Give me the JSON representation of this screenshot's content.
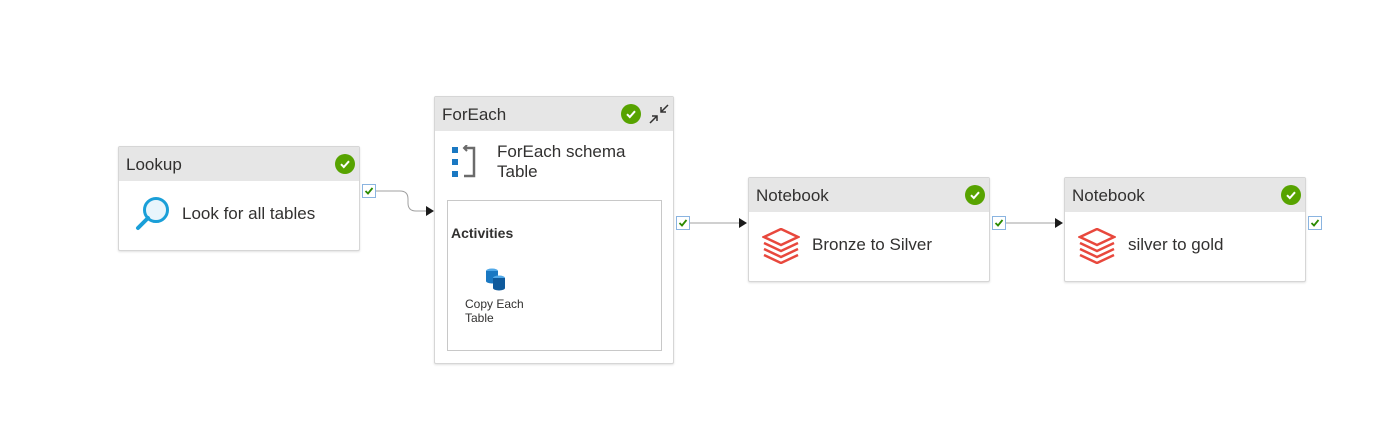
{
  "nodes": {
    "lookup": {
      "type_label": "Lookup",
      "title": "Look for all tables",
      "status": "succeeded"
    },
    "foreach": {
      "type_label": "ForEach",
      "title_line1": "ForEach schema",
      "title_line2": "Table",
      "activities_label": "Activities",
      "sub_activity": {
        "label_line1": "Copy Each",
        "label_line2": "Table"
      },
      "status": "succeeded"
    },
    "notebook1": {
      "type_label": "Notebook",
      "title": "Bronze to Silver",
      "status": "succeeded"
    },
    "notebook2": {
      "type_label": "Notebook",
      "title": "silver to gold",
      "status": "succeeded"
    }
  },
  "colors": {
    "success": "#57a300",
    "port_border": "#8ab4e0",
    "header_bg": "#e6e6e6",
    "databricks_red": "#e8483d",
    "lookup_blue": "#1a9fd8",
    "foreach_blue": "#1a78c2"
  },
  "icons": {
    "lookup": "magnifier-icon",
    "foreach": "foreach-icon",
    "notebook": "databricks-icon",
    "copy": "database-copy-icon",
    "status": "check-circle-icon",
    "collapse": "collapse-icon"
  }
}
